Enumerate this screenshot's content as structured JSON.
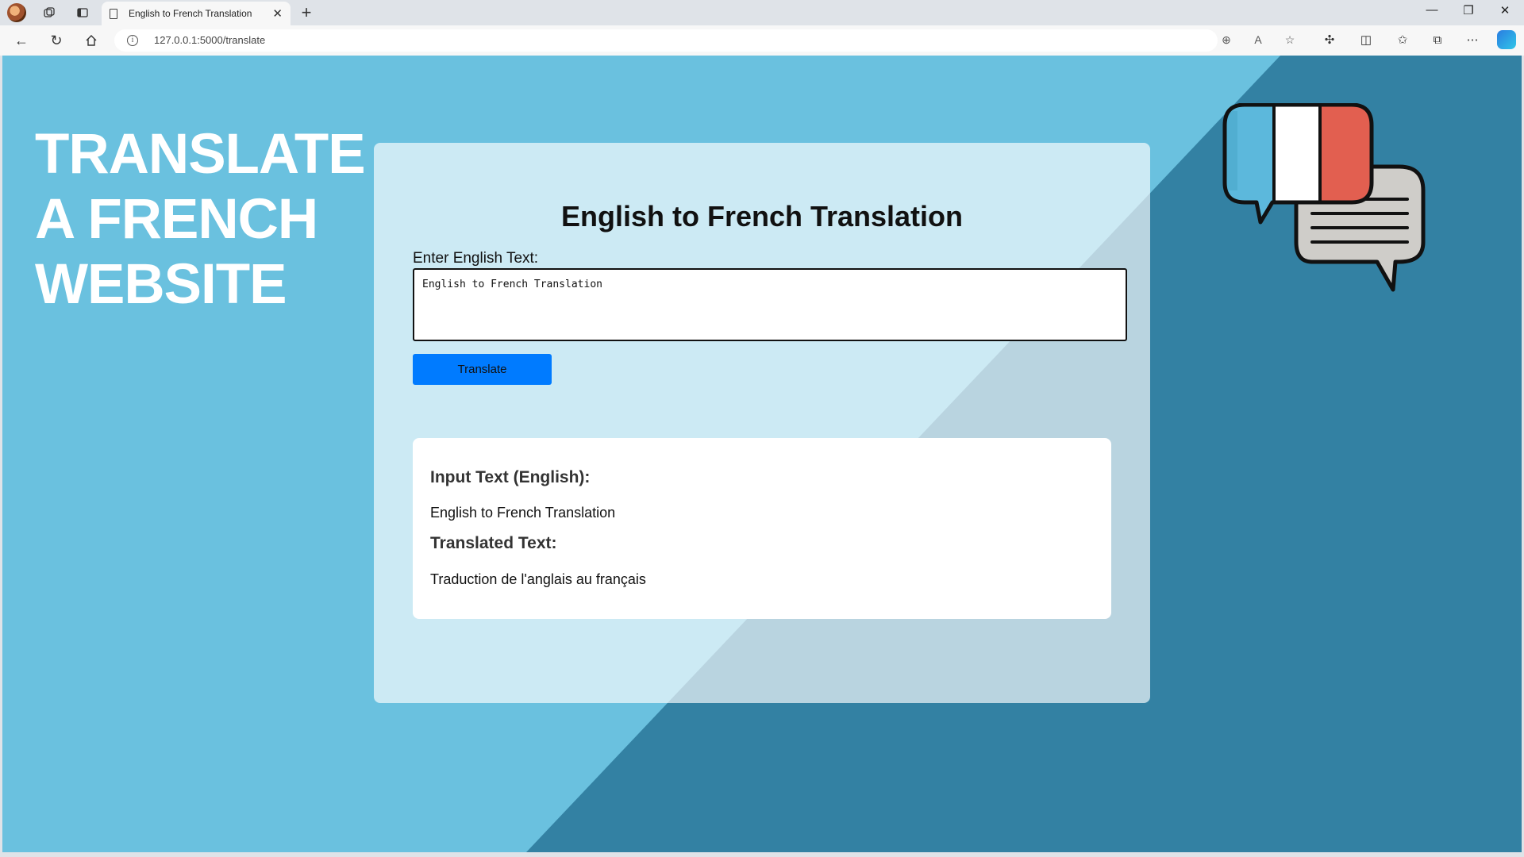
{
  "browser": {
    "tab_title": "English to French Translation",
    "tab_close": "✕",
    "new_tab": "+",
    "url": "127.0.0.1:5000/translate",
    "window_controls": {
      "minimize": "—",
      "restore": "❐",
      "close": "✕"
    }
  },
  "page": {
    "headline": [
      "TRANSLATE",
      "A FRENCH",
      "WEBSITE"
    ],
    "card_title": "English to French Translation",
    "input_label": "Enter English Text:",
    "input_value": "English to French Translation",
    "button_label": "Translate",
    "result": {
      "input_heading": "Input Text (English):",
      "input_text": "English to French Translation",
      "translated_heading": "Translated Text:",
      "translated_text": "Traduction de l'anglais au français"
    }
  },
  "colors": {
    "background_light": "#6ac1df",
    "background_dark": "#3381a3",
    "button": "#007bff",
    "flag_blue": "#5cb8dc",
    "flag_white": "#ffffff",
    "flag_red": "#e25f50",
    "bubble_gray": "#cfcdc9"
  },
  "icons": [
    "profile-avatar",
    "workspaces-icon",
    "tab-actions-icon",
    "document-icon",
    "back-icon",
    "refresh-icon",
    "home-icon",
    "info-icon",
    "zoom-icon",
    "read-aloud-icon",
    "favorite-star-icon",
    "extensions-icon",
    "split-screen-icon",
    "favorites-icon",
    "collections-icon",
    "more-icon",
    "copilot-icon",
    "chat-bubbles-icon"
  ]
}
